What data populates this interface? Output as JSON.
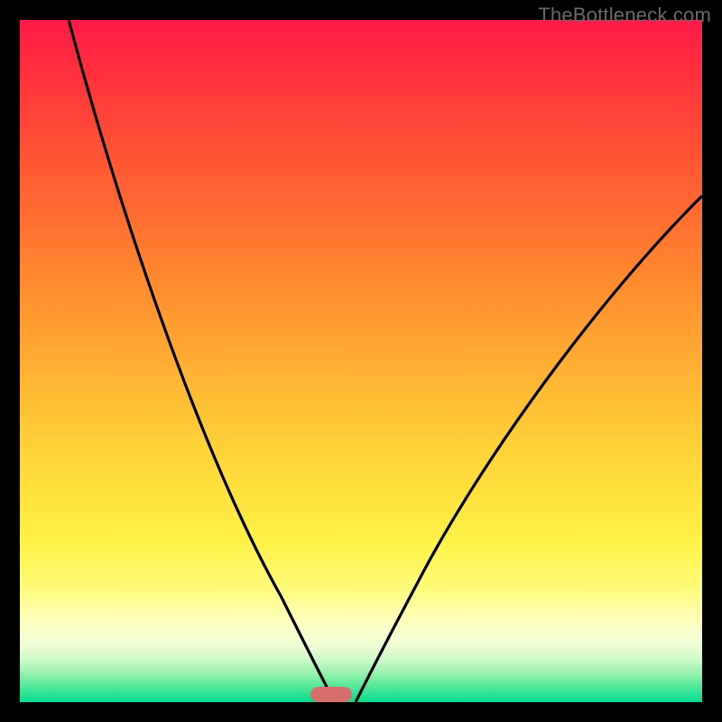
{
  "watermark": "TheBottleneck.com",
  "chart_data": {
    "type": "line",
    "title": "",
    "xlabel": "",
    "ylabel": "",
    "xlim": [
      0,
      100
    ],
    "ylim": [
      0,
      100
    ],
    "background_gradient": {
      "top": "#ff1a49",
      "mid": "#ffd038",
      "bottom": "#06dc8e"
    },
    "series": [
      {
        "name": "left-curve",
        "x": [
          7,
          10,
          14,
          18,
          22,
          26,
          30,
          34,
          38,
          41,
          43.5,
          45.3,
          46.1
        ],
        "y": [
          98,
          88,
          76,
          65,
          55,
          45,
          36,
          28,
          19,
          11,
          5,
          1,
          0
        ]
      },
      {
        "name": "right-curve",
        "x": [
          49.2,
          50,
          52,
          55,
          59,
          64,
          70,
          76,
          83,
          90,
          96,
          100
        ],
        "y": [
          0,
          1,
          4,
          9,
          16,
          25,
          35,
          44,
          54,
          63,
          70,
          74
        ]
      }
    ],
    "marker": {
      "x_center_pct": 45.6,
      "width_pct": 6.1,
      "color": "#d66e6e"
    }
  }
}
